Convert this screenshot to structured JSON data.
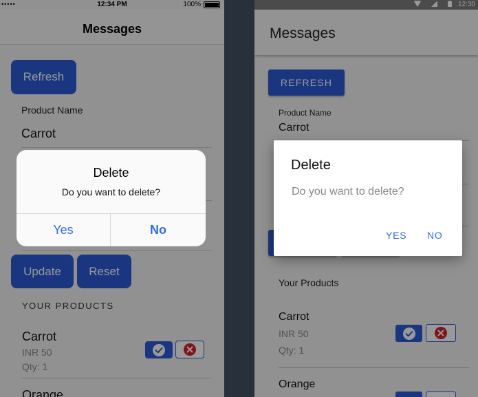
{
  "ios": {
    "status": {
      "signal": "••••• ",
      "time": "12:34 PM",
      "battery": "100%"
    },
    "nav_title": "Messages",
    "refresh_label": "Refresh",
    "product_name_label": "Product Name",
    "product_name_value": "Carrot",
    "update_label": "Update",
    "reset_label": "Reset",
    "section_title": "YOUR PRODUCTS",
    "products": [
      {
        "name": "Carrot",
        "price": "INR 50",
        "qty": "Qty: 1"
      },
      {
        "name": "Orange"
      }
    ],
    "dialog": {
      "title": "Delete",
      "message": "Do you want to delete?",
      "yes": "Yes",
      "no": "No"
    }
  },
  "android": {
    "status": {
      "time": "12:30"
    },
    "app_title": "Messages",
    "refresh_label": "REFRESH",
    "product_name_label": "Product Name",
    "product_name_value": "Carrot",
    "section_title": "Your Products",
    "products": [
      {
        "name": "Carrot",
        "price": "INR 50",
        "qty": "Qty: 1"
      },
      {
        "name": "Orange"
      }
    ],
    "dialog": {
      "title": "Delete",
      "message": "Do you want to delete?",
      "yes": "YES",
      "no": "NO"
    }
  },
  "colors": {
    "primary": "#2d5bd6",
    "dialog_button": "#2f6de0",
    "delete_red": "#d0222a"
  }
}
